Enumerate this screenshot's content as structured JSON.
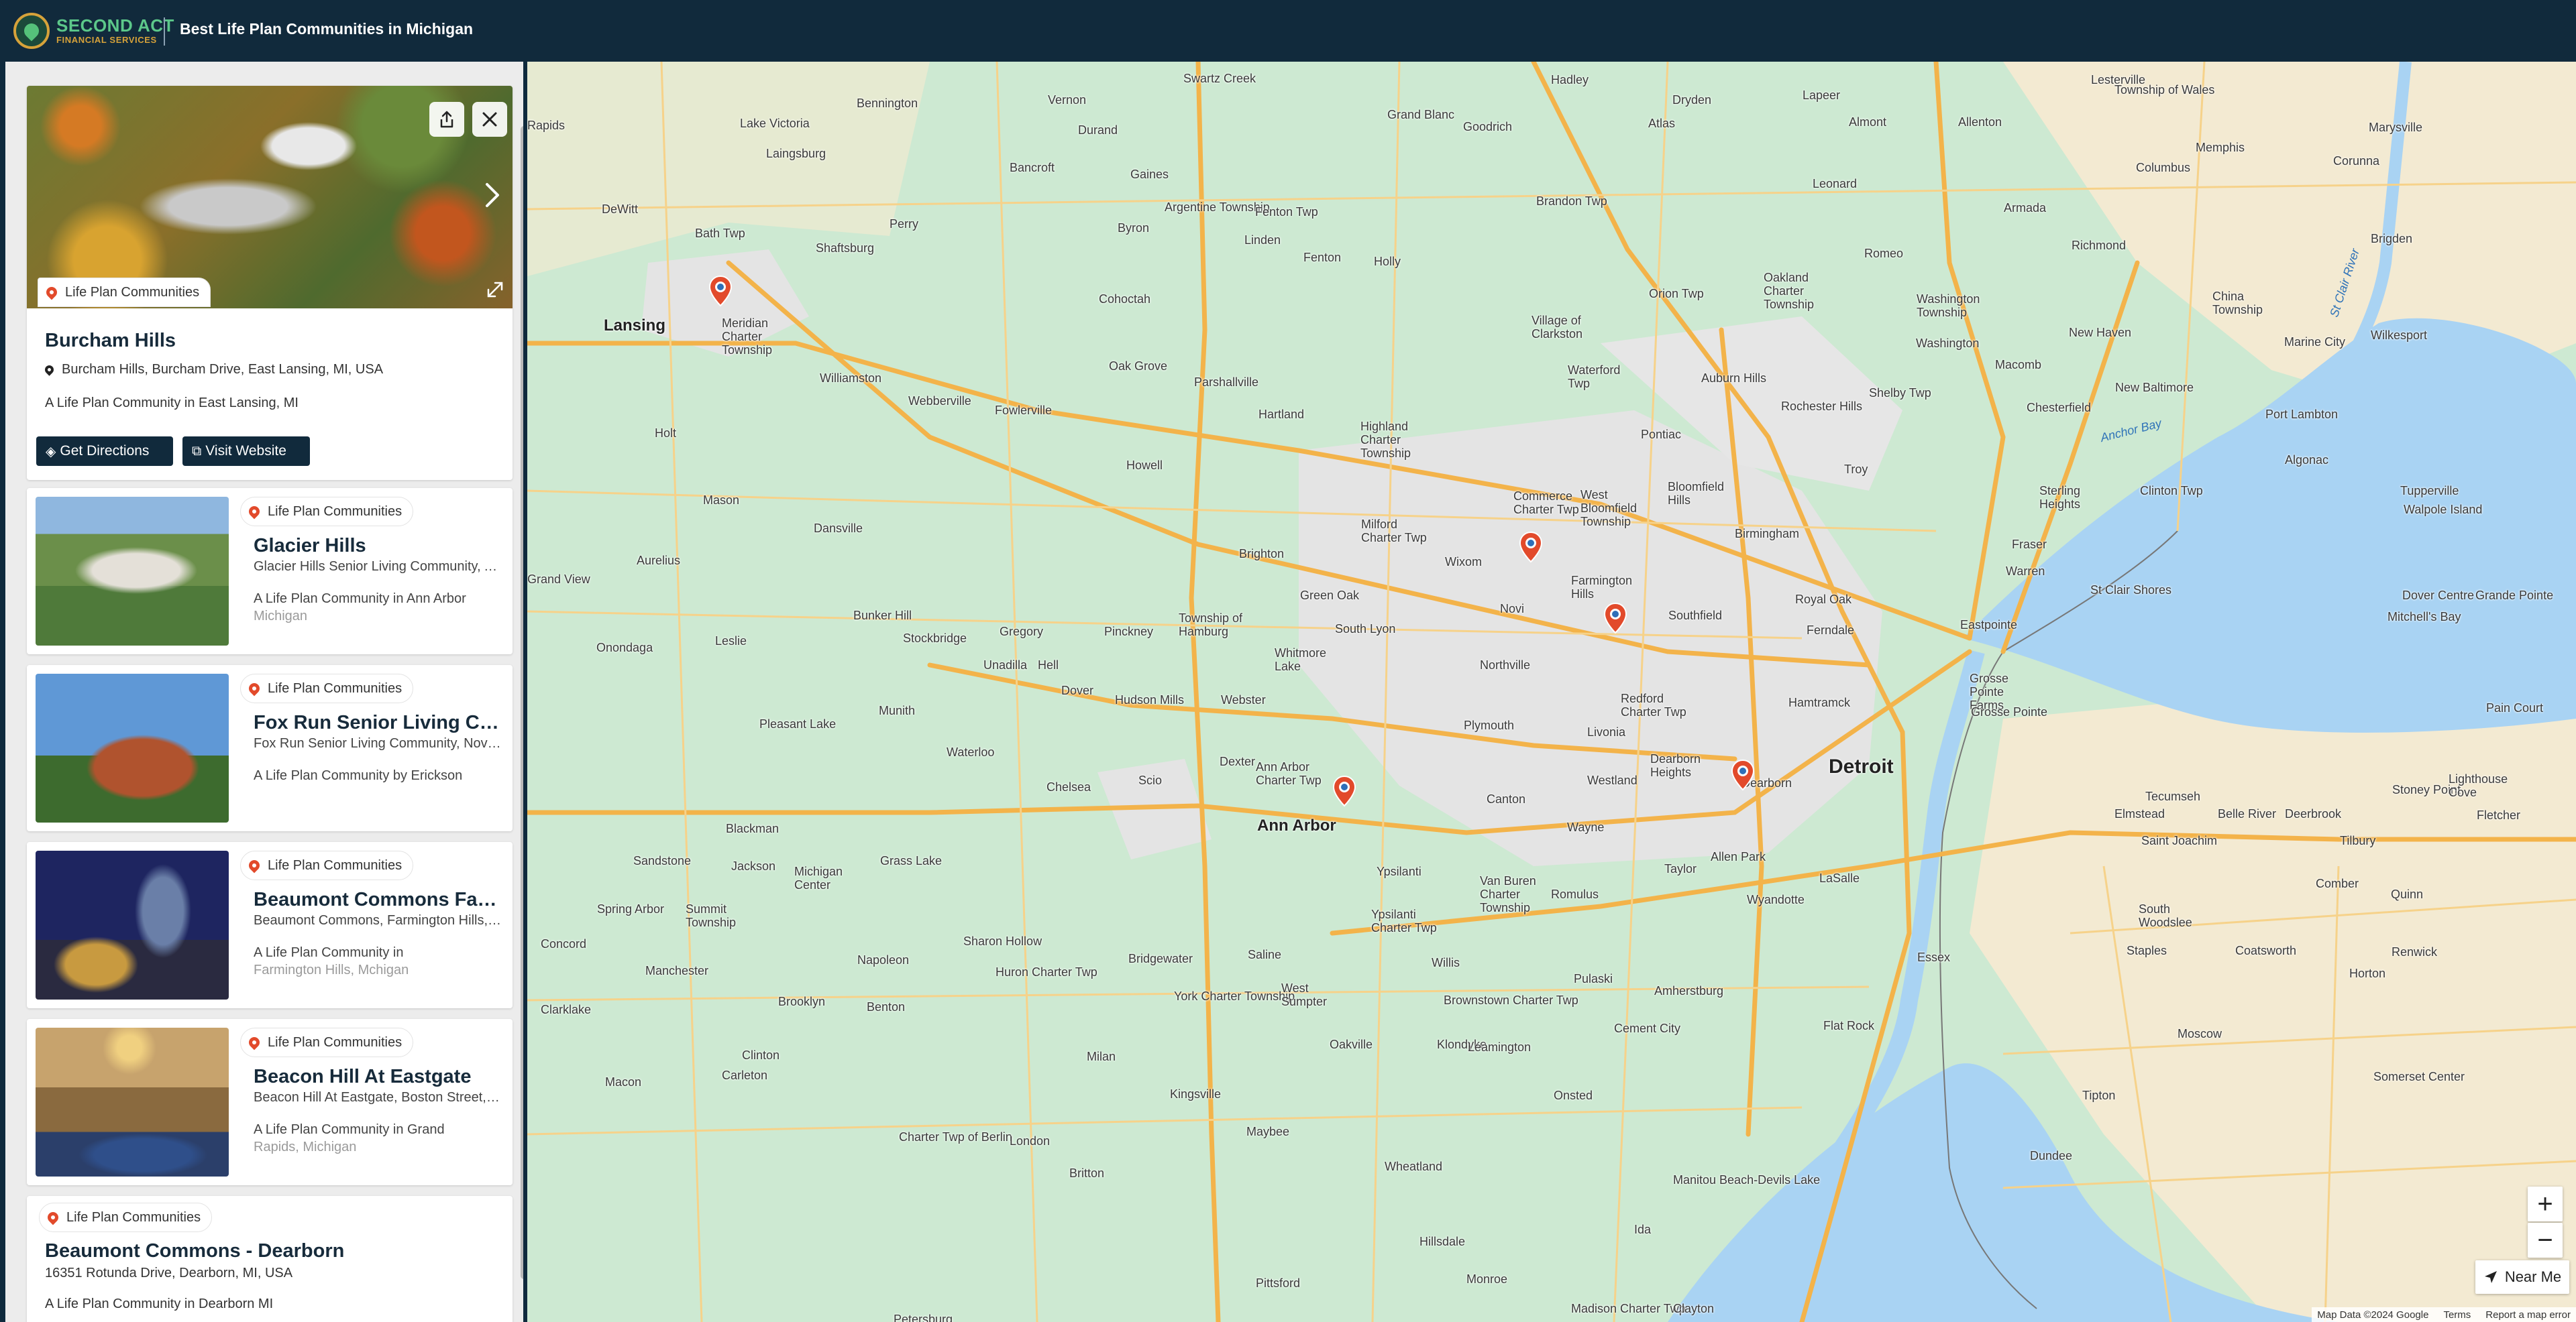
{
  "header": {
    "logo_line1": "SECOND ACT",
    "logo_line2": "FINANCIAL SERVICES",
    "title": "Best Life Plan Communities in Michigan"
  },
  "featured": {
    "category": "Life Plan Communities",
    "title": "Burcham Hills",
    "address": "Burcham Hills, Burcham Drive, East Lansing, MI, USA",
    "description": "A Life Plan Community in East Lansing, MI",
    "directions_label": "Get Directions",
    "website_label": "Visit Website"
  },
  "listings": [
    {
      "category": "Life Plan Communities",
      "title": "Glacier Hills",
      "subtitle": "Glacier Hills Senior Living Community, Ann Arbor, MI, USA",
      "desc_line1": "A Life Plan Community in Ann Arbor",
      "desc_line2": "Michigan"
    },
    {
      "category": "Life Plan Communities",
      "title": "Fox Run Senior Living Community",
      "subtitle": "Fox Run Senior Living Community, Novi, MI, USA",
      "desc_line1": "A Life Plan Community by Erickson",
      "desc_line2": ""
    },
    {
      "category": "Life Plan Communities",
      "title": "Beaumont Commons Farmington Hills",
      "subtitle": "Beaumont Commons, Farmington Hills, MI, USA",
      "desc_line1": "A Life Plan Community in",
      "desc_line2": "Farmington Hills, Mchigan"
    },
    {
      "category": "Life Plan Communities",
      "title": "Beacon Hill At Eastgate",
      "subtitle": "Beacon Hill At Eastgate, Boston Street, Grand Rapids, MI, USA",
      "desc_line1": "A Life Plan Community in Grand",
      "desc_line2": "Rapids, Michigan"
    }
  ],
  "last_listing": {
    "category": "Life Plan Communities",
    "title": "Beaumont Commons - Dearborn",
    "address": "16351 Rotunda Drive, Dearborn, MI, USA",
    "description": "A Life Plan Community in Dearborn MI"
  },
  "map": {
    "places": [
      "Swartz Creek",
      "Grand Blanc",
      "Hadley",
      "Lapeer",
      "Lesterville",
      "Township of Wales",
      "Marysville",
      "Vernon",
      "Atlas",
      "Goodrich",
      "Dryden",
      "Almont",
      "Allenton",
      "Memphis",
      "Corunna",
      "Lake Victoria",
      "Bennington",
      "Durand",
      "DeWitt",
      "Bath Twp",
      "Laingsburg",
      "Shaftsburg",
      "Bancroft",
      "Gaines",
      "Argentine Township",
      "Fenton Twp",
      "Linden",
      "Fenton",
      "Holly",
      "Brandon Twp",
      "Leonard",
      "Armada",
      "Richmond",
      "Columbus",
      "Brigden",
      "Lansing",
      "Meridian Charter Township",
      "Perry",
      "Byron",
      "Cohoctah",
      "Orion Twp",
      "Romeo",
      "Oakland Charter Township",
      "Washington Township",
      "Washington",
      "China Township",
      "Marine City",
      "Wilkesport",
      "Williamston",
      "Oak Grove",
      "Village of Clarkston",
      "Waterford Twp",
      "Auburn Hills",
      "Rochester Hills",
      "Shelby Twp",
      "Macomb",
      "New Haven",
      "New Baltimore",
      "Chesterfield",
      "Port Lambton",
      "Holt",
      "Webberville",
      "Fowlerville",
      "Parshallville",
      "Hartland",
      "Highland Charter Township",
      "Pontiac",
      "Troy",
      "Sterling Heights",
      "Clinton Twp",
      "Algonac",
      "Tupperville",
      "Walpole Island",
      "Mason",
      "Howell",
      "Commerce Charter Twp",
      "West Bloomfield Township",
      "Bloomfield Hills",
      "Birmingham",
      "Fraser",
      "Warren",
      "St Clair Shores",
      "Dover Centre",
      "Mitchell's Bay",
      "Dansville",
      "Aurelius",
      "Milford Charter Twp",
      "Wixom",
      "Farmington Hills",
      "Royal Oak",
      "Ferndale",
      "Eastpointe",
      "Grande Pointe",
      "Bunker Hill",
      "Brighton",
      "Green Oak",
      "Novi",
      "Southfield",
      "Grosse Pointe Farms",
      "Grosse Pointe",
      "Onondaga",
      "Leslie",
      "Stockbridge",
      "Gregory",
      "Pinckney",
      "Township of Hamburg",
      "South Lyon",
      "Whitmore Lake",
      "Northville",
      "Redford Charter Twp",
      "Hamtramck",
      "Pain Court",
      "Unadilla",
      "Hell",
      "Dover",
      "Hudson Mills",
      "Webster",
      "Plymouth",
      "Livonia",
      "Pleasant Lake",
      "Munith",
      "Waterloo",
      "Dexter",
      "Dearborn Heights",
      "Detroit",
      "Stoney Point",
      "Tecumseh",
      "Chelsea",
      "Scio",
      "Ann Arbor Charter Twp",
      "Canton",
      "Westland",
      "Dearborn",
      "Elmstead",
      "Belle River",
      "Deerbrook",
      "Fletcher",
      "Lighthouse Cove",
      "Blackman",
      "Ann Arbor",
      "Wayne",
      "Saint Joachim",
      "Tilbury",
      "Sandstone",
      "Jackson",
      "Michigan Center",
      "Grass Lake",
      "Ypsilanti",
      "Van Buren Charter Township",
      "Romulus",
      "Taylor",
      "Allen Park",
      "Wyandotte",
      "LaSalle",
      "Comber",
      "Spring Arbor",
      "Summit Township",
      "Ypsilanti Charter Twp",
      "South Woodslee",
      "Quinn",
      "Concord",
      "Napoleon",
      "Sharon Hollow",
      "Bridgewater",
      "Saline",
      "Willis",
      "Essex",
      "Staples",
      "Coatsworth",
      "Renwick",
      "Horton",
      "Manchester",
      "Huron Charter Twp",
      "Pulaski",
      "Clarklake",
      "Brooklyn",
      "Benton",
      "York Charter Township",
      "West Sumpter",
      "Brownstown Charter Twp",
      "Amherstburg",
      "Flat Rock",
      "Cement City",
      "Clinton",
      "Milan",
      "Oakville",
      "Klondyke",
      "Leamington",
      "Moscow",
      "Somerset Center",
      "Macon",
      "Carleton",
      "Kingsville",
      "Onsted",
      "Tipton",
      "Charter Twp of Berlin",
      "London",
      "Maybee",
      "Wheatland",
      "Manitou Beach-Devils Lake",
      "Britton",
      "Dundee",
      "Hillsdale",
      "Ida",
      "Monroe",
      "Pittsford",
      "Madison Charter Twp",
      "Clayton",
      "Petersburg",
      "Grand View",
      "Rapids",
      "Lake"
    ],
    "water_labels": [
      "Anchor Bay",
      "St Clair River"
    ],
    "near_me_label": "Near Me",
    "zoom_in": "+",
    "zoom_out": "−",
    "attribution": [
      "Map Data ©2024 Google",
      "Terms",
      "Report a map error"
    ]
  },
  "icons": {
    "share": "share-icon",
    "close": "close-icon",
    "next": "chevron-right-icon",
    "expand": "expand-icon",
    "pin": "map-pin-icon",
    "directions": "directions-icon",
    "external": "external-link-icon",
    "navigate": "navigation-arrow-icon"
  },
  "colors": {
    "header_bg": "#112a3c",
    "accent_green": "#5cc88a",
    "accent_gold": "#d6a23a",
    "marker_red": "#e24a2b",
    "button_bg": "#112a3c"
  }
}
